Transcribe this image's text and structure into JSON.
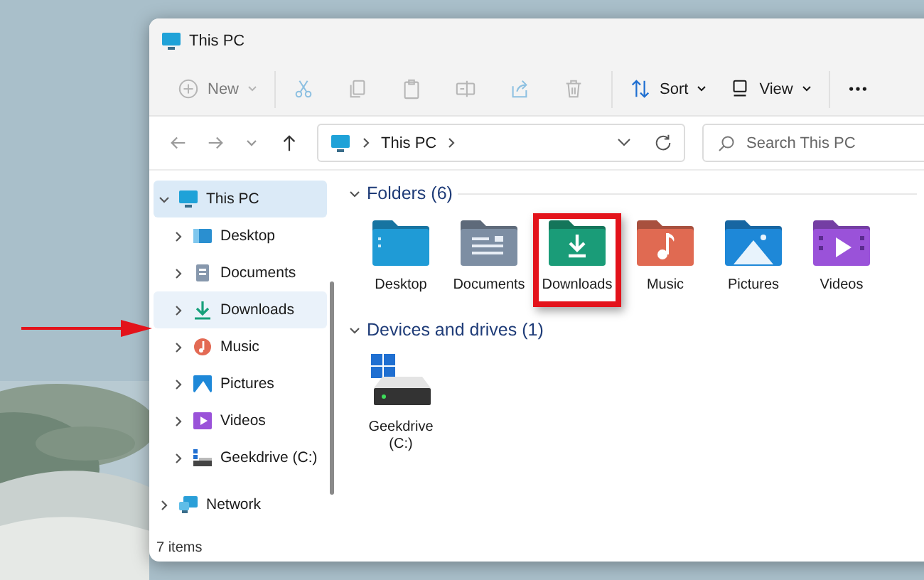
{
  "window": {
    "title": "This PC"
  },
  "toolbar": [
    {
      "kind": "new",
      "label": "New",
      "disabled": true
    },
    {
      "kind": "cut",
      "disabled": true
    },
    {
      "kind": "copy",
      "disabled": true
    },
    {
      "kind": "paste",
      "disabled": true
    },
    {
      "kind": "rename",
      "disabled": true
    },
    {
      "kind": "share",
      "disabled": true
    },
    {
      "kind": "delete",
      "disabled": true
    },
    {
      "kind": "sort",
      "label": "Sort",
      "disabled": false
    },
    {
      "kind": "view",
      "label": "View",
      "disabled": false
    },
    {
      "kind": "more",
      "disabled": false
    }
  ],
  "nav": [
    {
      "kind": "back",
      "disabled": true
    },
    {
      "kind": "forward",
      "disabled": true
    },
    {
      "kind": "recent",
      "disabled": true
    },
    {
      "kind": "up",
      "disabled": false
    }
  ],
  "address": {
    "path": [
      "This PC"
    ]
  },
  "search": {
    "placeholder": "Search This PC"
  },
  "sidebar": {
    "items": [
      {
        "kind": "pc",
        "label": "This PC",
        "selected": true,
        "hovered": false,
        "expanded": true,
        "children": [
          {
            "kind": "desktop",
            "label": "Desktop",
            "selected": false,
            "hovered": false,
            "expanded": false
          },
          {
            "kind": "documents",
            "label": "Documents",
            "selected": false,
            "hovered": false,
            "expanded": false
          },
          {
            "kind": "downloads",
            "label": "Downloads",
            "selected": false,
            "hovered": true,
            "expanded": false
          },
          {
            "kind": "music",
            "label": "Music",
            "selected": false,
            "hovered": false,
            "expanded": false
          },
          {
            "kind": "pictures",
            "label": "Pictures",
            "selected": false,
            "hovered": false,
            "expanded": false
          },
          {
            "kind": "videos",
            "label": "Videos",
            "selected": false,
            "hovered": false,
            "expanded": false
          },
          {
            "kind": "drive",
            "label": "Geekdrive (C:)",
            "selected": false,
            "hovered": false,
            "expanded": false
          }
        ]
      },
      {
        "kind": "network",
        "label": "Network",
        "selected": false,
        "hovered": false,
        "expanded": false
      }
    ]
  },
  "sections": [
    {
      "title": "Folders (6)",
      "expanded": true,
      "items": [
        {
          "kind": "desktop",
          "label": "Desktop",
          "highlighted": false
        },
        {
          "kind": "documents",
          "label": "Documents",
          "highlighted": false
        },
        {
          "kind": "downloads",
          "label": "Downloads",
          "highlighted": true
        },
        {
          "kind": "music",
          "label": "Music",
          "highlighted": false
        },
        {
          "kind": "pictures",
          "label": "Pictures",
          "highlighted": false
        },
        {
          "kind": "videos",
          "label": "Videos",
          "highlighted": false
        }
      ]
    },
    {
      "title": "Devices and drives (1)",
      "expanded": true,
      "items": [
        {
          "kind": "drive",
          "label": "Geekdrive (C:)",
          "highlighted": false
        }
      ]
    }
  ],
  "status_bar": {
    "text": "7 items"
  }
}
